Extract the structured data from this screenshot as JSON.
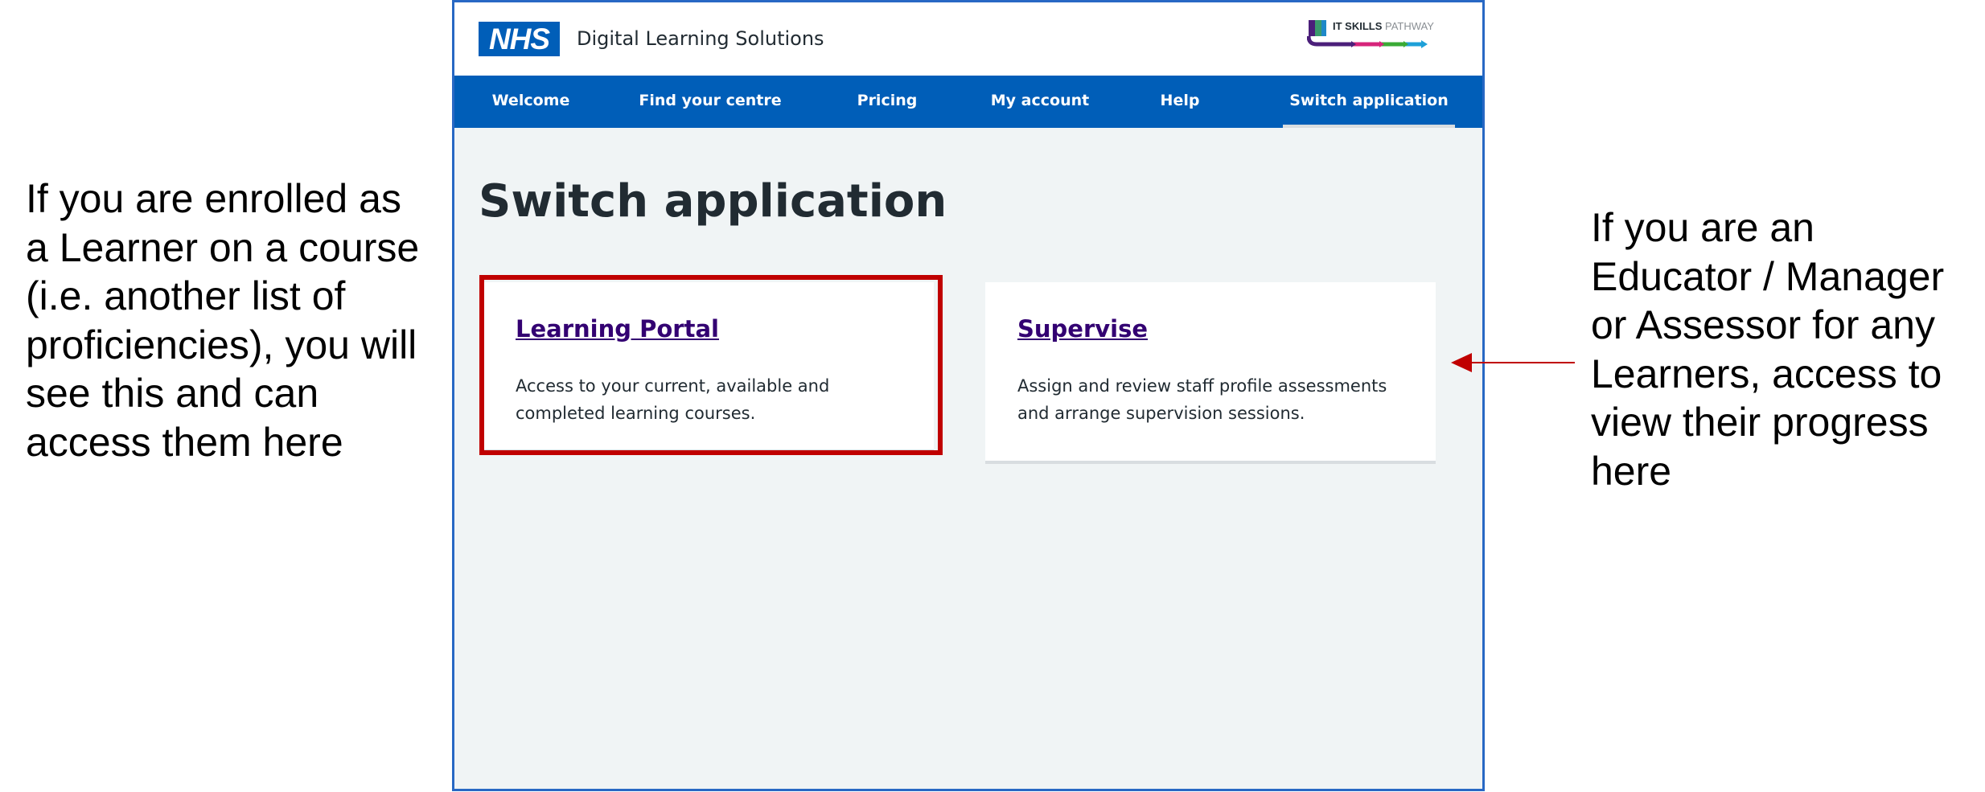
{
  "annotations": {
    "left_lines": [
      "If you are enrolled as",
      "a Learner on a course",
      "(i.e. another list of",
      "proficiencies), you will",
      "see this and can",
      "access them here"
    ],
    "right_lines": [
      "If you are an",
      "Educator / Manager",
      "or Assessor for any",
      "Learners, access to",
      "view their progress",
      "here"
    ]
  },
  "header": {
    "logo_text": "NHS",
    "service_name": "Digital Learning Solutions",
    "partner_logo": {
      "bold": "IT SKILLS",
      "light": "PATHWAY"
    }
  },
  "nav": {
    "items": [
      {
        "label": "Welcome",
        "active": false
      },
      {
        "label": "Find your centre",
        "active": false
      },
      {
        "label": "Pricing",
        "active": false
      },
      {
        "label": "My account",
        "active": false
      },
      {
        "label": "Help",
        "active": false
      },
      {
        "label": "Switch application",
        "active": true
      }
    ]
  },
  "main": {
    "title": "Switch application",
    "cards": [
      {
        "title": "Learning Portal",
        "description": "Access to your current, available and completed learning courses.",
        "highlighted": true
      },
      {
        "title": "Supervise",
        "description": "Assign and review staff profile assessments and arrange supervision sessions.",
        "highlighted": false
      }
    ]
  },
  "colors": {
    "nhs_blue": "#005eb8",
    "link_purple": "#330072",
    "highlight_red": "#c00000",
    "page_background": "#f0f4f5",
    "frame_border": "#2868c4"
  }
}
